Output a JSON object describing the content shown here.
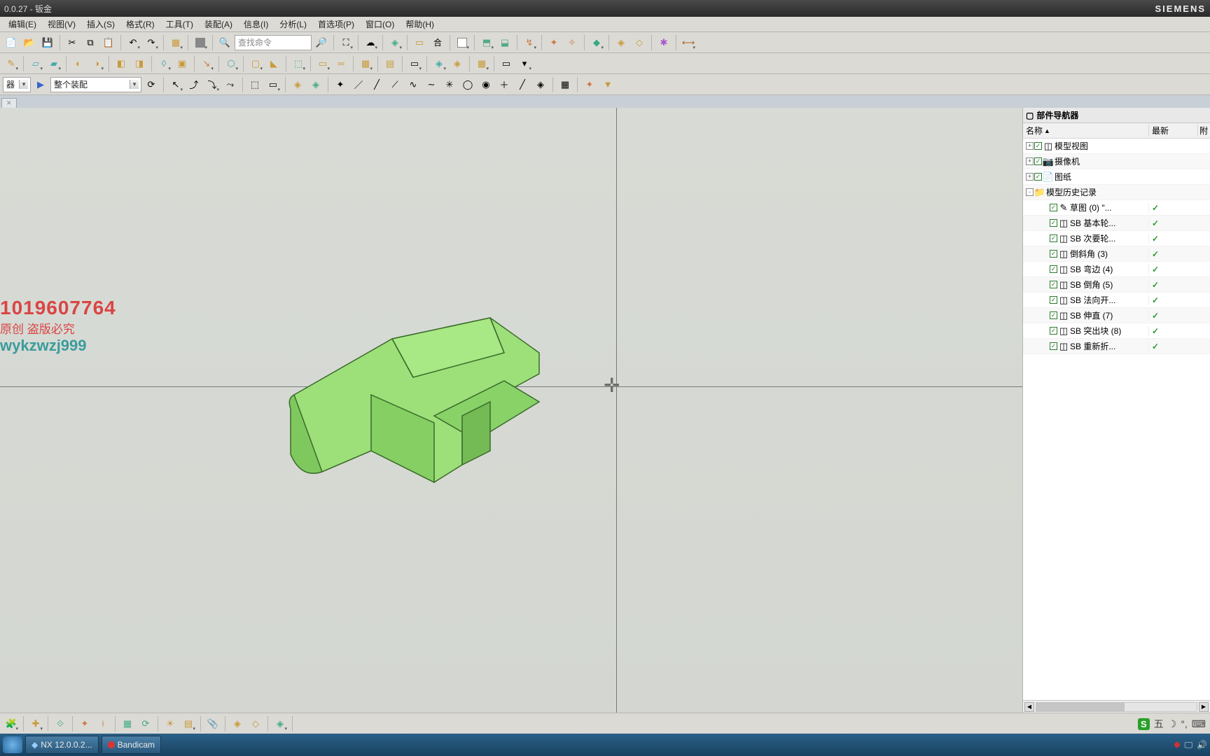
{
  "title_left": "0.0.27 - 钣金",
  "brand": "SIEMENS",
  "menu": [
    "编辑(E)",
    "视图(V)",
    "插入(S)",
    "格式(R)",
    "工具(T)",
    "装配(A)",
    "信息(I)",
    "分析(L)",
    "首选项(P)",
    "窗口(O)",
    "帮助(H)"
  ],
  "search_placeholder": "查找命令",
  "filter_left_label": "器",
  "assembly_scope": "整个装配",
  "watermark": {
    "l1": "1019607764",
    "l2": "原创  盗版必究",
    "l3": "wykzwzj999"
  },
  "navigator": {
    "title": "部件导航器",
    "columns": [
      "名称",
      "最新",
      "附"
    ],
    "nodes": [
      {
        "indent": 0,
        "expand": "+",
        "check": true,
        "icon": "tree-icon",
        "label": "模型视图",
        "tick": false
      },
      {
        "indent": 0,
        "expand": "+",
        "check": true,
        "icon": "camera-icon",
        "label": "摄像机",
        "tick": false
      },
      {
        "indent": 0,
        "expand": "+",
        "check": true,
        "icon": "drawing-icon",
        "label": "图纸",
        "tick": false
      },
      {
        "indent": 0,
        "expand": "-",
        "check": false,
        "icon": "folder-icon",
        "label": "模型历史记录",
        "tick": false
      },
      {
        "indent": 1,
        "expand": "",
        "check": true,
        "icon": "sketch-icon",
        "label": "草图 (0) \"...",
        "tick": true
      },
      {
        "indent": 1,
        "expand": "",
        "check": true,
        "icon": "sb-icon",
        "label": "SB 基本轮...",
        "tick": true
      },
      {
        "indent": 1,
        "expand": "",
        "check": true,
        "icon": "sb-icon",
        "label": "SB 次要轮...",
        "tick": true
      },
      {
        "indent": 1,
        "expand": "",
        "check": true,
        "icon": "chamfer-icon",
        "label": "倒斜角 (3)",
        "tick": true
      },
      {
        "indent": 1,
        "expand": "",
        "check": true,
        "icon": "sb-icon",
        "label": "SB 弯边 (4)",
        "tick": true
      },
      {
        "indent": 1,
        "expand": "",
        "check": true,
        "icon": "sb-icon",
        "label": "SB 倒角 (5)",
        "tick": true
      },
      {
        "indent": 1,
        "expand": "",
        "check": true,
        "icon": "sb-icon",
        "label": "SB 法向开...",
        "tick": true
      },
      {
        "indent": 1,
        "expand": "",
        "check": true,
        "icon": "sb-icon",
        "label": "SB 伸直 (7)",
        "tick": true
      },
      {
        "indent": 1,
        "expand": "",
        "check": true,
        "icon": "sb-icon",
        "label": "SB 突出块 (8)",
        "tick": true
      },
      {
        "indent": 1,
        "expand": "",
        "check": true,
        "icon": "sb-icon",
        "label": "SB 重新折...",
        "tick": true
      }
    ]
  },
  "taskbar": {
    "app1": "NX 12.0.0.2...",
    "app2": "Bandicam"
  },
  "tray_right": {
    "ime": "五",
    "sogou": "S"
  }
}
